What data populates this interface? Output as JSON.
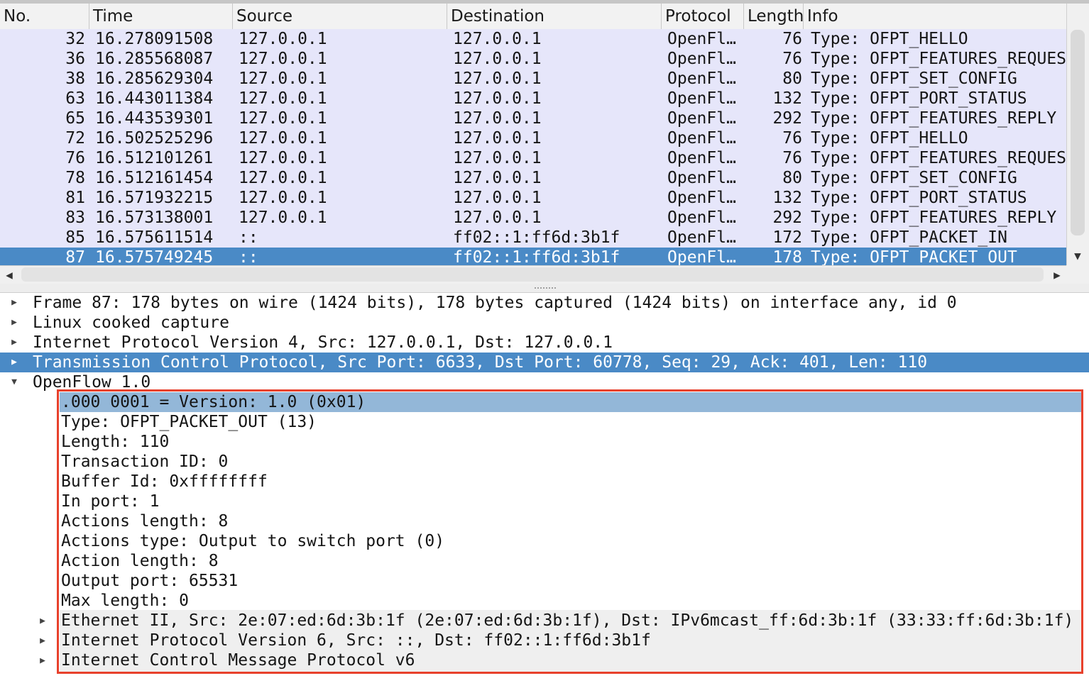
{
  "packet_list": {
    "columns": [
      "No.",
      "Time",
      "Source",
      "Destination",
      "Protocol",
      "Length",
      "Info"
    ],
    "rows": [
      {
        "no": "32",
        "time": "16.278091508",
        "source": "127.0.0.1",
        "destination": "127.0.0.1",
        "protocol": "OpenFl…",
        "length": "76",
        "info": "Type: OFPT_HELLO"
      },
      {
        "no": "36",
        "time": "16.285568087",
        "source": "127.0.0.1",
        "destination": "127.0.0.1",
        "protocol": "OpenFl…",
        "length": "76",
        "info": "Type: OFPT_FEATURES_REQUEST"
      },
      {
        "no": "38",
        "time": "16.285629304",
        "source": "127.0.0.1",
        "destination": "127.0.0.1",
        "protocol": "OpenFl…",
        "length": "80",
        "info": "Type: OFPT_SET_CONFIG"
      },
      {
        "no": "63",
        "time": "16.443011384",
        "source": "127.0.0.1",
        "destination": "127.0.0.1",
        "protocol": "OpenFl…",
        "length": "132",
        "info": "Type: OFPT_PORT_STATUS"
      },
      {
        "no": "65",
        "time": "16.443539301",
        "source": "127.0.0.1",
        "destination": "127.0.0.1",
        "protocol": "OpenFl…",
        "length": "292",
        "info": "Type: OFPT_FEATURES_REPLY"
      },
      {
        "no": "72",
        "time": "16.502525296",
        "source": "127.0.0.1",
        "destination": "127.0.0.1",
        "protocol": "OpenFl…",
        "length": "76",
        "info": "Type: OFPT_HELLO"
      },
      {
        "no": "76",
        "time": "16.512101261",
        "source": "127.0.0.1",
        "destination": "127.0.0.1",
        "protocol": "OpenFl…",
        "length": "76",
        "info": "Type: OFPT_FEATURES_REQUEST"
      },
      {
        "no": "78",
        "time": "16.512161454",
        "source": "127.0.0.1",
        "destination": "127.0.0.1",
        "protocol": "OpenFl…",
        "length": "80",
        "info": "Type: OFPT_SET_CONFIG"
      },
      {
        "no": "81",
        "time": "16.571932215",
        "source": "127.0.0.1",
        "destination": "127.0.0.1",
        "protocol": "OpenFl…",
        "length": "132",
        "info": "Type: OFPT_PORT_STATUS"
      },
      {
        "no": "83",
        "time": "16.573138001",
        "source": "127.0.0.1",
        "destination": "127.0.0.1",
        "protocol": "OpenFl…",
        "length": "292",
        "info": "Type: OFPT_FEATURES_REPLY"
      },
      {
        "no": "85",
        "time": "16.575611514",
        "source": "::",
        "destination": "ff02::1:ff6d:3b1f",
        "protocol": "OpenFl…",
        "length": "172",
        "info": "Type: OFPT_PACKET_IN"
      },
      {
        "no": "87",
        "time": "16.575749245",
        "source": "::",
        "destination": "ff02::1:ff6d:3b1f",
        "protocol": "OpenFl…",
        "length": "178",
        "info": "Type: OFPT_PACKET_OUT",
        "selected": true
      }
    ]
  },
  "detail": {
    "top_items": [
      {
        "text": "Frame 87: 178 bytes on wire (1424 bits), 178 bytes captured (1424 bits) on interface any, id 0",
        "expanded": false
      },
      {
        "text": "Linux cooked capture",
        "expanded": false
      },
      {
        "text": "Internet Protocol Version 4, Src: 127.0.0.1, Dst: 127.0.0.1",
        "expanded": false
      },
      {
        "text": "Transmission Control Protocol, Src Port: 6633, Dst Port: 60778, Seq: 29, Ack: 401, Len: 110",
        "expanded": false,
        "selected": true
      },
      {
        "text": "OpenFlow 1.0",
        "expanded": true
      }
    ],
    "openflow_fields": [
      ".000 0001 = Version: 1.0 (0x01)",
      "Type: OFPT_PACKET_OUT (13)",
      "Length: 110",
      "Transaction ID: 0",
      "Buffer Id: 0xffffffff",
      "In port: 1",
      "Actions length: 8",
      "Actions type: Output to switch port (0)",
      "Action length: 8",
      "Output port: 65531",
      "Max length: 0"
    ],
    "openflow_subtrees": [
      "Ethernet II, Src: 2e:07:ed:6d:3b:1f (2e:07:ed:6d:3b:1f), Dst: IPv6mcast_ff:6d:3b:1f (33:33:ff:6d:3b:1f)",
      "Internet Protocol Version 6, Src: ::, Dst: ff02::1:ff6d:3b1f",
      "Internet Control Message Protocol v6"
    ]
  },
  "icons": {
    "collapsed": "triangle-right-icon",
    "expanded": "triangle-down-icon"
  },
  "colors": {
    "row_bg": "#e6e6fa",
    "selection": "#4a8ac6",
    "field_highlight": "#93b7d8",
    "annotation_box": "#e8412c"
  }
}
